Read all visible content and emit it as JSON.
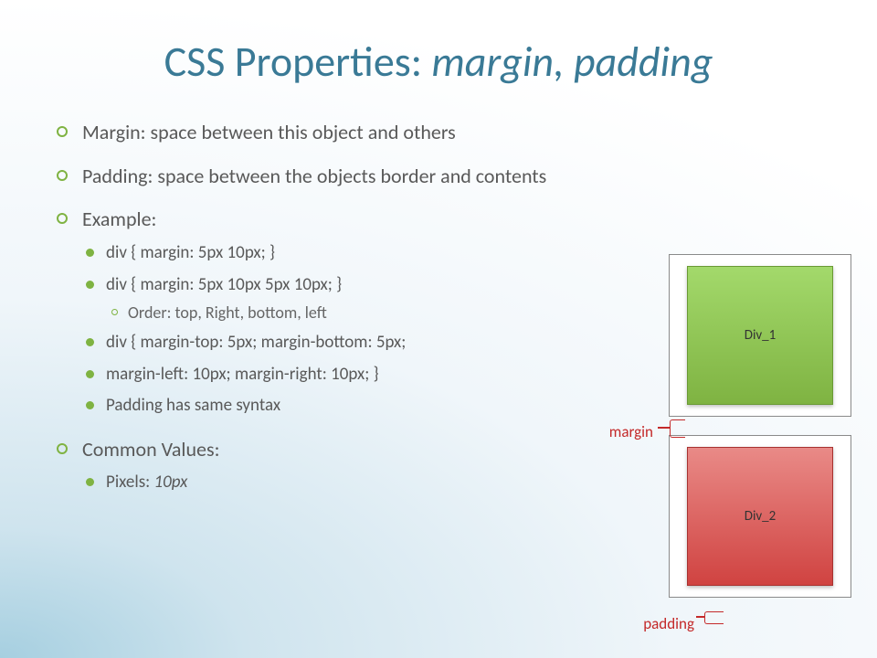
{
  "title_prefix": "CSS Properties: ",
  "title_italic": "margin, padding",
  "bullets": {
    "b1": "Margin: space between this object and others",
    "b2": "Padding: space between the objects border and contents",
    "b3": "Example:",
    "b3_sub": {
      "s1": "div { margin: 5px 10px; }",
      "s2": "div { margin: 5px 10px 5px 10px; }",
      "s2_sub": "Order: top, Right, bottom, left",
      "s3": "div { margin-top: 5px; margin-bottom: 5px;",
      "s4": "margin-left: 10px; margin-right: 10px; }",
      "s5": "Padding has same syntax"
    },
    "b4": "Common Values:",
    "b4_sub_prefix": "Pixels: ",
    "b4_sub_italic": "10px"
  },
  "diagram": {
    "box1": "Div_1",
    "box2": "Div_2",
    "margin_label": "margin",
    "padding_label": "padding"
  }
}
